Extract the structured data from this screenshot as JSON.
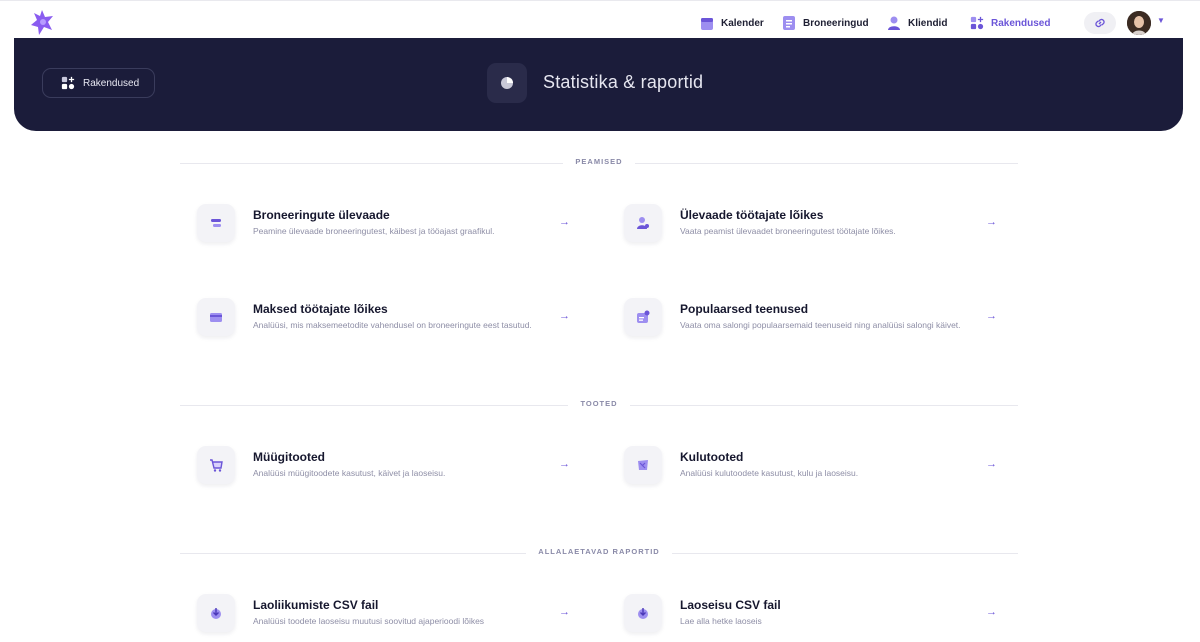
{
  "nav": {
    "items": [
      {
        "label": "Kalender",
        "icon": "calendar-icon"
      },
      {
        "label": "Broneeringud",
        "icon": "bookings-icon"
      },
      {
        "label": "Kliendid",
        "icon": "clients-icon"
      },
      {
        "label": "Rakendused",
        "icon": "apps-icon",
        "active": true
      }
    ]
  },
  "hero": {
    "back_label": "Rakendused",
    "title": "Statistika & raportid"
  },
  "sections": [
    {
      "label": "PEAMISED",
      "cards": [
        {
          "title": "Broneeringute ülevaade",
          "desc": "Peamine ülevaade broneeringutest, käibest ja tööajast graafikul."
        },
        {
          "title": "Ülevaade töötajate lõikes",
          "desc": "Vaata peamist ülevaadet broneeringutest töötajate lõikes."
        },
        {
          "title": "Maksed töötajate lõikes",
          "desc": "Analüüsi, mis maksemeetodite vahendusel on broneeringute eest tasutud."
        },
        {
          "title": "Populaarsed teenused",
          "desc": "Vaata oma salongi populaarsemaid teenuseid ning analüüsi salongi käivet."
        }
      ]
    },
    {
      "label": "TOOTED",
      "cards": [
        {
          "title": "Müügitooted",
          "desc": "Analüüsi müügitoodete kasutust, käivet ja laoseisu."
        },
        {
          "title": "Kulutooted",
          "desc": "Analüüsi kulutoodete kasutust, kulu ja laoseisu."
        }
      ]
    },
    {
      "label": "ALLALAETAVAD RAPORTID",
      "cards": [
        {
          "title": "Laoliikumiste CSV fail",
          "desc": "Analüüsi toodete laoseisu muutusi soovitud ajaperioodi lõikes"
        },
        {
          "title": "Laoseisu CSV fail",
          "desc": "Lae alla hetke laoseis"
        }
      ]
    }
  ],
  "colors": {
    "accent": "#6b55d8",
    "hero_bg": "#1b1c3a"
  }
}
